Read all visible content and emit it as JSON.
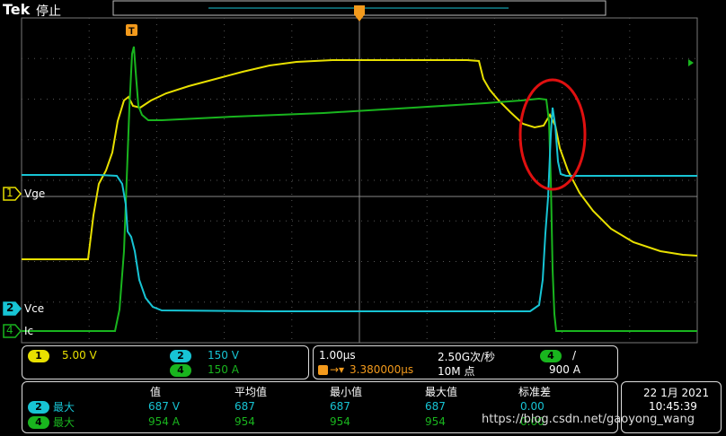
{
  "header": {
    "brand": "Tek",
    "state": "停止"
  },
  "trigger_marker": "T",
  "channels": {
    "ch1": {
      "num": "1",
      "label": "Vge",
      "color": "#e8e000"
    },
    "ch2": {
      "num": "2",
      "label": "Vce",
      "color": "#17c4d4"
    },
    "ch4": {
      "num": "4",
      "label": "Ic",
      "color": "#19b51e"
    }
  },
  "scale_panel": {
    "ch1_scale": "5.00 V",
    "ch2_scale": "150 V",
    "ch4_scale": "150 A"
  },
  "timebase_panel": {
    "time_per_div": "1.00µs",
    "sample_rate": "2.50G次/秒",
    "trigger_channel": "4",
    "trigger_slope": "/",
    "trigger_delay": "3.380000µs",
    "record_length": "10M 点",
    "trigger_level": "900 A"
  },
  "measurements": {
    "headers": [
      "值",
      "平均值",
      "最小值",
      "最大值",
      "标准差"
    ],
    "rows": [
      {
        "channel": "2",
        "type": "最大",
        "values": [
          "687 V",
          "687",
          "687",
          "687",
          "0.00"
        ]
      },
      {
        "channel": "4",
        "type": "最大",
        "values": [
          "954 A",
          "954",
          "954",
          "954",
          "0.00"
        ]
      }
    ]
  },
  "datetime": {
    "date": "22 1月 2021",
    "time": "10:45:39"
  },
  "watermark": "https://blog.csdn.net/gaoyong_wang"
}
